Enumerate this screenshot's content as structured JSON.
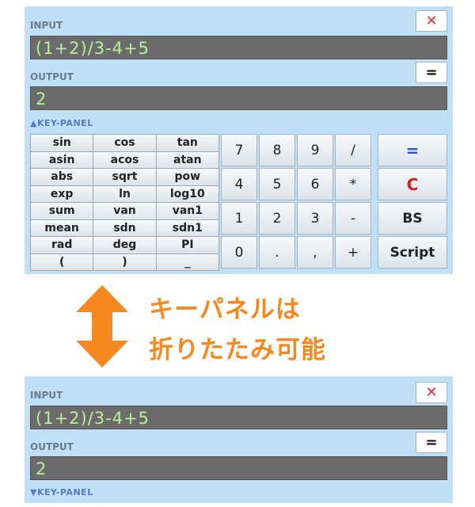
{
  "top_panel": {
    "input_label": "INPUT",
    "close_label": "✕",
    "input_value": "(1+2)/3-4+5",
    "output_label": "OUTPUT",
    "equals_label": "=",
    "output_value": "2",
    "keypanel_label": "▲KEY-PANEL",
    "function_keys": [
      "sin",
      "cos",
      "tan",
      "asin",
      "acos",
      "atan",
      "abs",
      "sqrt",
      "pow",
      "exp",
      "ln",
      "log10",
      "sum",
      "van",
      "van1",
      "mean",
      "sdn",
      "sdn1",
      "rad",
      "deg",
      "PI",
      "(",
      ")",
      "_"
    ],
    "number_keys": [
      "7",
      "8",
      "9",
      "/",
      "4",
      "5",
      "6",
      "*",
      "1",
      "2",
      "3",
      "-",
      "0",
      ".",
      ",",
      "+"
    ],
    "operator_keys": [
      "=",
      "C",
      "BS",
      "Script"
    ]
  },
  "caption": {
    "line1": "キーパネルは",
    "line2": "折りたたみ可能"
  },
  "bottom_panel": {
    "input_label": "INPUT",
    "close_label": "✕",
    "input_value": "(1+2)/3-4+5",
    "output_label": "OUTPUT",
    "equals_label": "=",
    "output_value": "2",
    "keypanel_label": "▼KEY-PANEL"
  },
  "colors": {
    "panel_bg": "#bfe0f7",
    "display_bg": "#6b6b6b",
    "display_text": "#b8f09b",
    "arrow": "#f7881f",
    "caption": "#f7881f"
  }
}
